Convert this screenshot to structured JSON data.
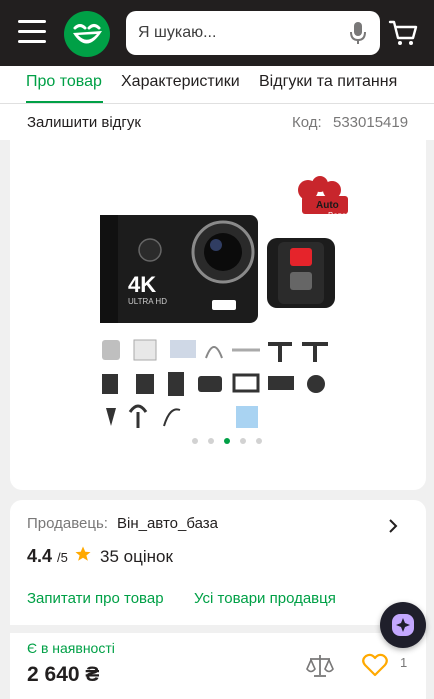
{
  "header": {
    "search_placeholder": "Я шукаю...",
    "brand_color": "#00a046"
  },
  "tabs": [
    {
      "label": "Про товар",
      "active": true
    },
    {
      "label": "Характеристики",
      "active": false
    },
    {
      "label": "Відгуки та питання",
      "active": false
    }
  ],
  "product": {
    "review_link": "Залишити відгук",
    "code_label": "Код:",
    "code_value": "533015419",
    "image_badge": "4K",
    "image_sub": "ULTRA HD",
    "brand_logo": "Auto Baza",
    "gallery_dots": 5,
    "gallery_active_index": 2
  },
  "seller": {
    "label": "Продавець:",
    "name": "Він_авто_база",
    "rating": "4.4",
    "rating_max": "/5",
    "reviews": "35 оцінок",
    "ask_link": "Запитати про товар",
    "all_goods_link": "Усі товари продавця"
  },
  "purchase": {
    "availability": "Є в наявності",
    "price": "2 640 ₴",
    "favorites_count": "1"
  }
}
